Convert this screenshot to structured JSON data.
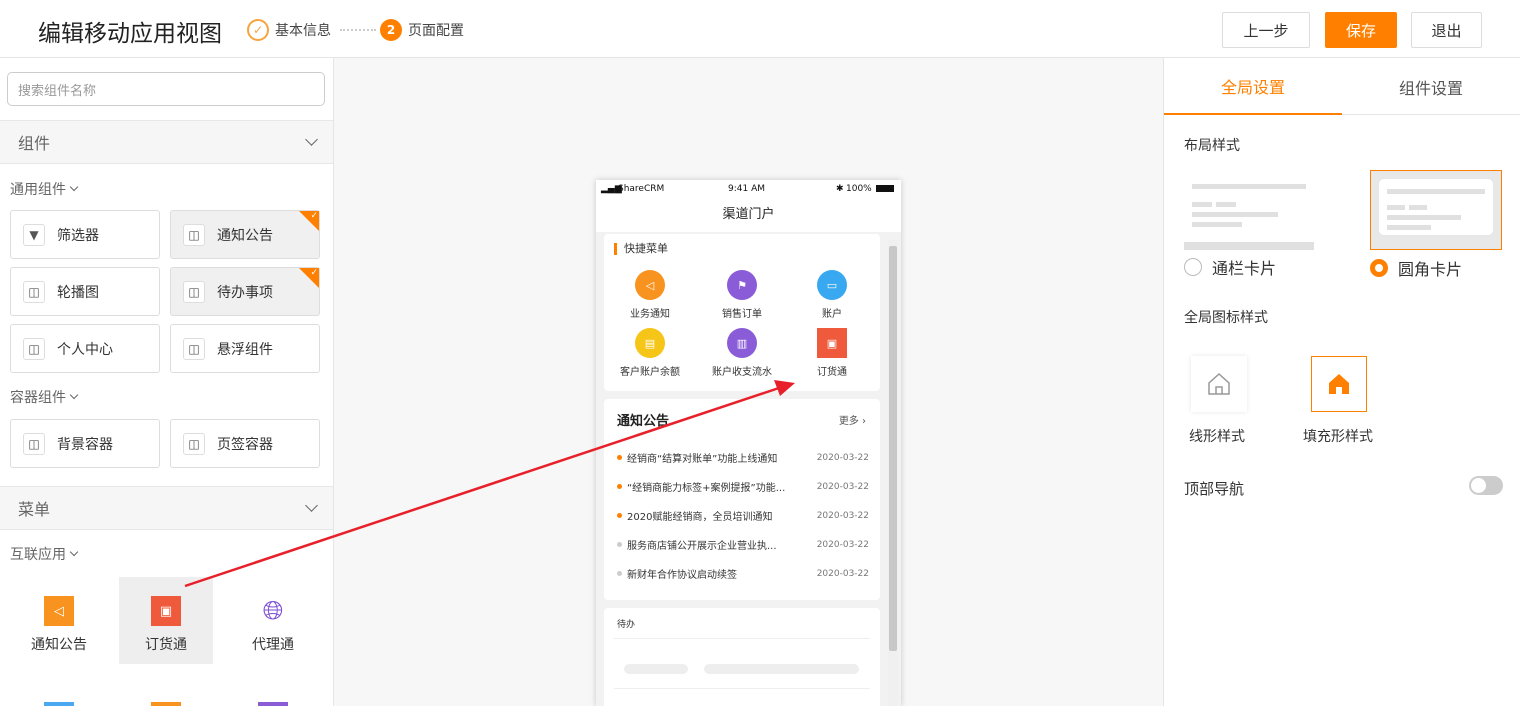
{
  "header": {
    "title": "编辑移动应用视图",
    "step1": "基本信息",
    "step2_num": "2",
    "step2": "页面配置",
    "btn_prev": "上一步",
    "btn_save": "保存",
    "btn_exit": "退出"
  },
  "left": {
    "search_placeholder": "搜索组件名称",
    "section_components": "组件",
    "sub_general": "通用组件",
    "general_items": [
      "筛选器",
      "通知公告",
      "轮播图",
      "待办事项",
      "个人中心",
      "悬浮组件"
    ],
    "sub_container": "容器组件",
    "container_items": [
      "背景容器",
      "页签容器"
    ],
    "section_menu": "菜单",
    "sub_interconnect": "互联应用",
    "apps": [
      "通知公告",
      "订货通",
      "代理通"
    ]
  },
  "phone": {
    "carrier": "ShareCRM",
    "time": "9:41 AM",
    "battery": "100%",
    "title": "渠道门户",
    "quick_menu_title": "快捷菜单",
    "quick_items": [
      "业务通知",
      "销售订单",
      "账户",
      "客户账户余额",
      "账户收支流水",
      "订货通"
    ],
    "notice_title": "通知公告",
    "notice_more": "更多",
    "notices": [
      {
        "text": "经销商“结算对账单”功能上线通知",
        "date": "2020-03-22"
      },
      {
        "text": "“经销商能力标签+案例提报”功能...",
        "date": "2020-03-22"
      },
      {
        "text": "2020赋能经销商，全员培训通知",
        "date": "2020-03-22"
      },
      {
        "text": "服务商店铺公开展示企业营业执...",
        "date": "2020-03-22"
      },
      {
        "text": "新财年合作协议启动续签",
        "date": "2020-03-22"
      }
    ],
    "todo_title": "待办"
  },
  "right": {
    "tab_global": "全局设置",
    "tab_component": "组件设置",
    "layout_label": "布局样式",
    "layout_option1": "通栏卡片",
    "layout_option2": "圆角卡片",
    "icon_style_label": "全局图标样式",
    "icon_style1": "线形样式",
    "icon_style2": "填充形样式",
    "top_nav_label": "顶部导航"
  },
  "colors": {
    "accent": "#ff8000",
    "arrow": "#e8202a"
  }
}
